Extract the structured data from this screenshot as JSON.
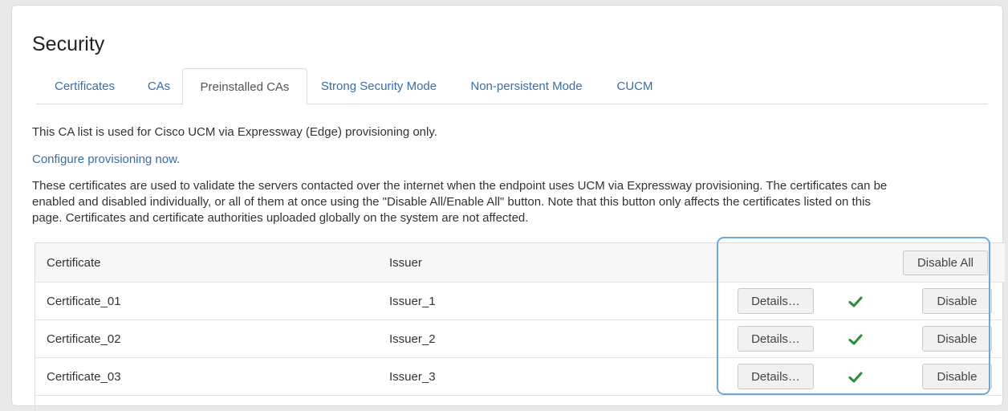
{
  "page": {
    "title": "Security"
  },
  "tabs": [
    {
      "label": "Certificates"
    },
    {
      "label": "CAs"
    },
    {
      "label": "Preinstalled CAs"
    },
    {
      "label": "Strong Security Mode"
    },
    {
      "label": "Non-persistent Mode"
    },
    {
      "label": "CUCM"
    }
  ],
  "active_tab": "Preinstalled CAs",
  "intro_text": "This CA list is used for Cisco UCM via Expressway (Edge) provisioning only.",
  "configure_link": "Configure provisioning now.",
  "description_lines": [
    "These certificates are used to validate the servers contacted over the internet when the endpoint uses UCM via Expressway provisioning. The certificates can be",
    "enabled and disabled individually, or all of them at once using the \"Disable All/Enable All\" button. Note that this button only affects the certificates listed on this",
    "page. Certificates and certificate authorities uploaded globally on the system are not affected."
  ],
  "table": {
    "headers": {
      "certificate": "Certificate",
      "issuer": "Issuer"
    },
    "disable_all_label": "Disable All",
    "rows": [
      {
        "certificate": "Certificate_01",
        "issuer": "Issuer_1",
        "details_label": "Details…",
        "status": "enabled",
        "action_label": "Disable"
      },
      {
        "certificate": "Certificate_02",
        "issuer": "Issuer_2",
        "details_label": "Details…",
        "status": "enabled",
        "action_label": "Disable"
      },
      {
        "certificate": "Certificate_03",
        "issuer": "Issuer_3",
        "details_label": "Details…",
        "status": "enabled",
        "action_label": "Disable"
      }
    ]
  },
  "colors": {
    "link": "#3a6ea5",
    "check": "#2e8b3a",
    "highlight": "#6aa9d8"
  },
  "icons": {
    "status": "check-icon"
  }
}
